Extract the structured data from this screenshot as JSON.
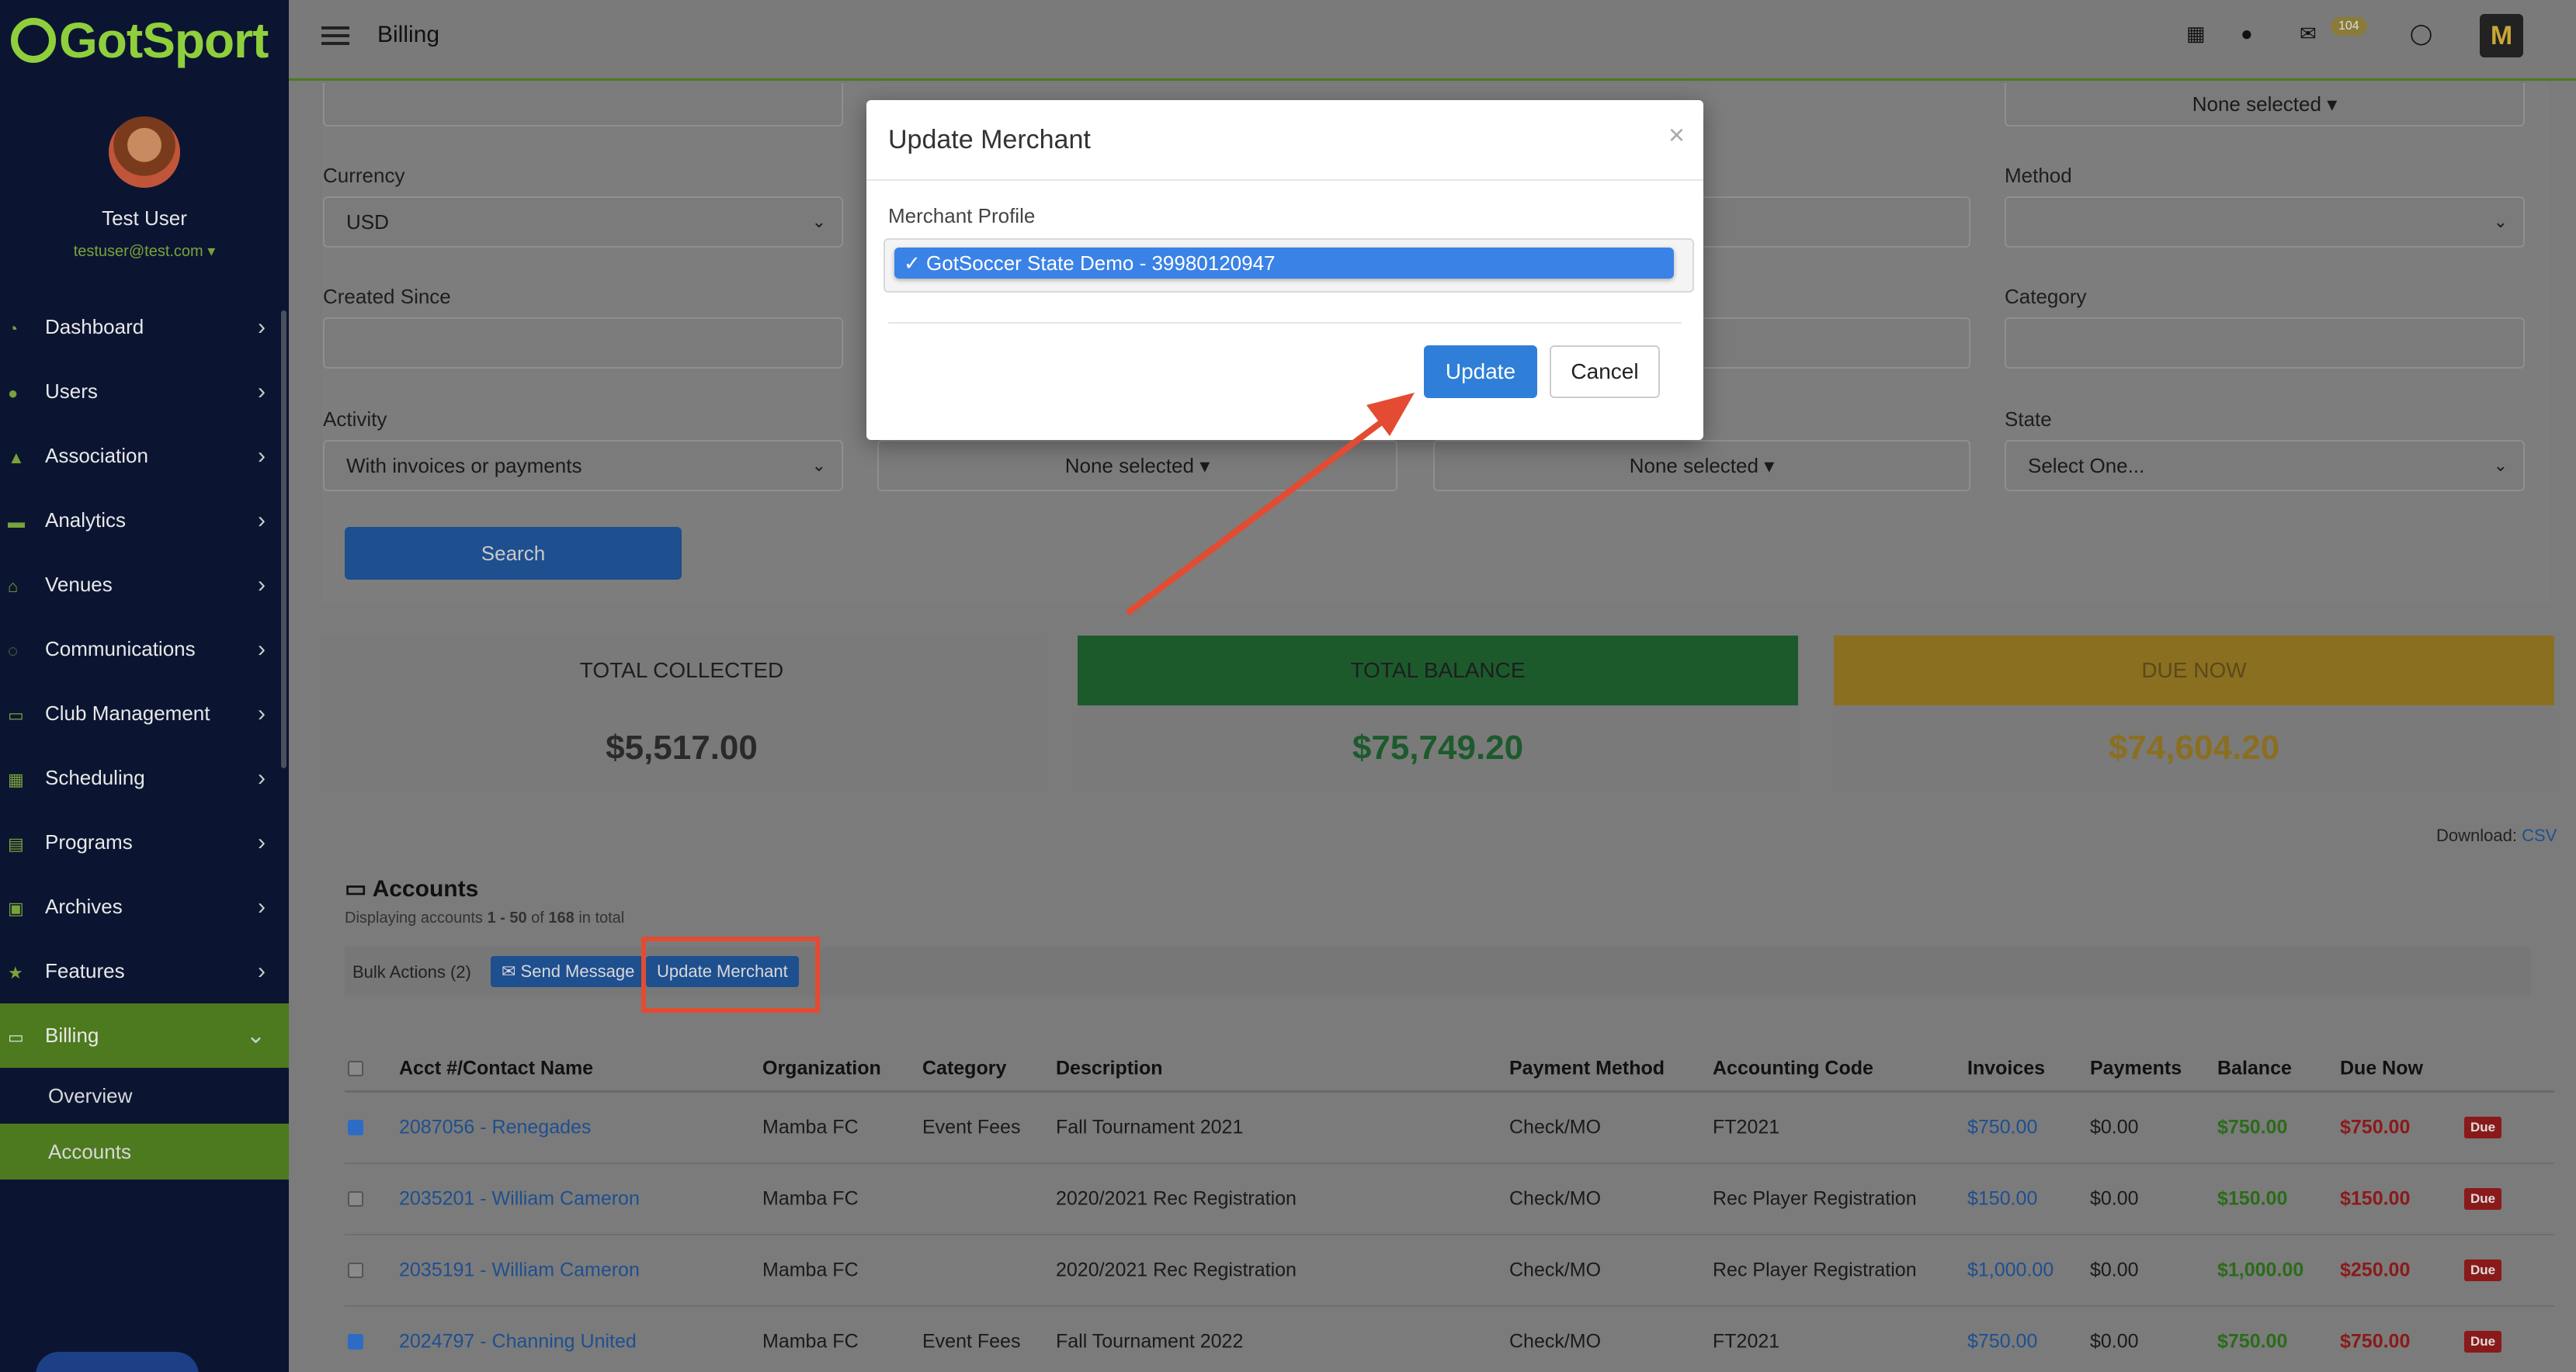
{
  "app": {
    "logo_text": "GotSport",
    "page_title": "Billing",
    "mail_badge": "104",
    "user_logo": "M"
  },
  "sidebar": {
    "user_name": "Test User",
    "user_email": "testuser@test.com ▾",
    "items": [
      {
        "label": "Dashboard",
        "icon": "dashboard-icon"
      },
      {
        "label": "Users",
        "icon": "users-icon"
      },
      {
        "label": "Association",
        "icon": "association-icon"
      },
      {
        "label": "Analytics",
        "icon": "analytics-icon"
      },
      {
        "label": "Venues",
        "icon": "venues-icon"
      },
      {
        "label": "Communications",
        "icon": "communications-icon"
      },
      {
        "label": "Club Management",
        "icon": "club-icon"
      },
      {
        "label": "Scheduling",
        "icon": "scheduling-icon"
      },
      {
        "label": "Programs",
        "icon": "programs-icon"
      },
      {
        "label": "Archives",
        "icon": "archives-icon"
      },
      {
        "label": "Features",
        "icon": "star-icon"
      },
      {
        "label": "Billing",
        "icon": "billing-icon"
      }
    ],
    "sub_items": [
      "Overview",
      "Accounts"
    ]
  },
  "filters": {
    "top_right_value": "None selected",
    "currency_label": "Currency",
    "currency_value": "USD",
    "mid_value": "elected",
    "method_label": "Method",
    "created_label": "Created Since",
    "category_label": "Category",
    "activity_label": "Activity",
    "activity_value": "With invoices or payments",
    "none_selected_1": "None selected",
    "none_selected_2": "None selected",
    "state_label": "State",
    "state_value": "Select One...",
    "search_label": "Search"
  },
  "stats": [
    {
      "label": "TOTAL COLLECTED",
      "value": "$5,517.00"
    },
    {
      "label": "TOTAL BALANCE",
      "value": "$75,749.20"
    },
    {
      "label": "DUE NOW",
      "value": "$74,604.20"
    }
  ],
  "download": {
    "label": "Download:",
    "link": "CSV"
  },
  "accounts": {
    "title": "Accounts",
    "subtitle_pre": "Displaying accounts ",
    "subtitle_range": "1 - 50",
    "subtitle_mid": " of ",
    "subtitle_total": "168",
    "subtitle_post": " in total",
    "bulk_label": "Bulk Actions (2)",
    "send_message": "Send Message",
    "update_merchant": "Update Merchant",
    "headers": [
      "Acct #/Contact Name",
      "Organization",
      "Category",
      "Description",
      "Payment Method",
      "Accounting Code",
      "Invoices",
      "Payments",
      "Balance",
      "Due Now"
    ],
    "rows": [
      {
        "checked": true,
        "acct": "2087056 - Renegades",
        "org": "Mamba FC",
        "category": "Event Fees",
        "desc": "Fall Tournament 2021",
        "method": "Check/MO",
        "code": "FT2021",
        "invoices": "$750.00",
        "payments": "$0.00",
        "balance": "$750.00",
        "due": "$750.00",
        "status": "Due"
      },
      {
        "checked": false,
        "acct": "2035201 - William Cameron",
        "org": "Mamba FC",
        "category": "",
        "desc": "2020/2021 Rec Registration",
        "method": "Check/MO",
        "code": "Rec Player Registration",
        "invoices": "$150.00",
        "payments": "$0.00",
        "balance": "$150.00",
        "due": "$150.00",
        "status": "Due"
      },
      {
        "checked": false,
        "acct": "2035191 - William Cameron",
        "org": "Mamba FC",
        "category": "",
        "desc": "2020/2021 Rec Registration",
        "method": "Check/MO",
        "code": "Rec Player Registration",
        "invoices": "$1,000.00",
        "payments": "$0.00",
        "balance": "$1,000.00",
        "due": "$250.00",
        "status": "Due"
      },
      {
        "checked": true,
        "acct": "2024797 - Channing United",
        "org": "Mamba FC",
        "category": "Event Fees",
        "desc": "Fall Tournament 2022",
        "method": "Check/MO",
        "code": "FT2021",
        "invoices": "$750.00",
        "payments": "$0.00",
        "balance": "$750.00",
        "due": "$750.00",
        "status": "Due"
      }
    ]
  },
  "modal": {
    "title": "Update Merchant",
    "close": "×",
    "field_label": "Merchant Profile",
    "selected_option": "✓ GotSoccer State Demo - 39980120947",
    "update_label": "Update",
    "cancel_label": "Cancel"
  },
  "colors": {
    "brand_green": "#8fcf3c",
    "annotation_red": "#e34b32",
    "primary_blue": "#2f7fd8"
  }
}
